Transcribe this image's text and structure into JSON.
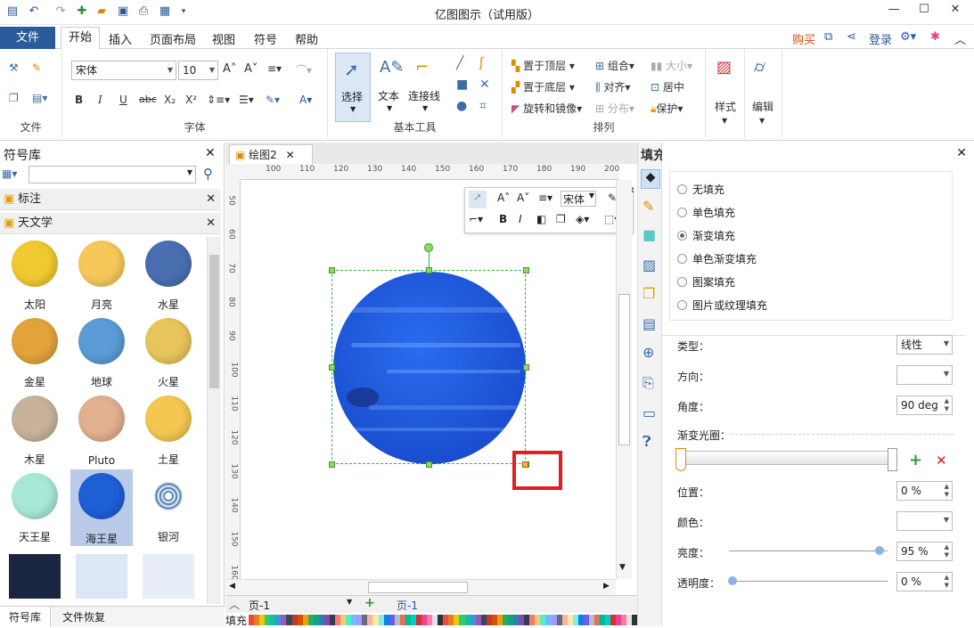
{
  "app": {
    "title": "亿图图示（试用版）"
  },
  "menu": {
    "file": "文件",
    "tabs": [
      "开始",
      "插入",
      "页面布局",
      "视图",
      "符号",
      "帮助"
    ],
    "buy": "购买",
    "login": "登录"
  },
  "ribbon": {
    "file_group": "文件",
    "font_group": "字体",
    "font_name": "宋体",
    "font_size": "10",
    "basic_tools": "基本工具",
    "select": "选择",
    "text": "文本",
    "connector": "连接线",
    "arrange": "排列",
    "top": "置于顶层",
    "bottom": "置于底层",
    "rotate": "旋转和镜像",
    "group": "组合",
    "align": "对齐",
    "distribute": "分布",
    "size": "大小",
    "center": "居中",
    "protect": "保护",
    "style": "样式",
    "edit": "编辑"
  },
  "library": {
    "title": "符号库",
    "sections": [
      "标注",
      "天文学"
    ],
    "symbols": [
      {
        "label": "太阳",
        "color": "#f0c92e"
      },
      {
        "label": "月亮",
        "color": "#f6c85a"
      },
      {
        "label": "水星",
        "color": "#4a6fb0"
      },
      {
        "label": "金星",
        "color": "#e2a33a"
      },
      {
        "label": "地球",
        "color": "#5b9bd5"
      },
      {
        "label": "火星",
        "color": "#e8c55a"
      },
      {
        "label": "木星",
        "color": "#c8b29a"
      },
      {
        "label": "Pluto",
        "color": "#e0b08f"
      },
      {
        "label": "土星",
        "color": "#f4c750"
      },
      {
        "label": "天王星",
        "color": "#a8e8d8"
      },
      {
        "label": "海王星",
        "color": "#1f5fd6"
      },
      {
        "label": "银河",
        "color": "#ffffff"
      }
    ],
    "bottom_tabs": [
      "符号库",
      "文件恢复"
    ]
  },
  "document": {
    "tab": "绘图2",
    "ruler_h": [
      "100",
      "110",
      "120",
      "130",
      "140",
      "150",
      "160",
      "170",
      "180",
      "190",
      "200"
    ],
    "ruler_v": [
      "50",
      "60",
      "70",
      "80",
      "90",
      "100",
      "110",
      "120",
      "130",
      "140",
      "150",
      "160"
    ],
    "page_label": "页-1",
    "page_tab": "页-1",
    "fill_label": "填充"
  },
  "floatbar": {
    "font": "宋体"
  },
  "fill_panel": {
    "title": "填充",
    "options": [
      "无填充",
      "单色填充",
      "渐变填充",
      "单色渐变填充",
      "图案填充",
      "图片或纹理填充"
    ],
    "selected": 2,
    "type_label": "类型：",
    "type_value": "线性",
    "direction_label": "方向：",
    "angle_label": "角度：",
    "angle_value": "90 deg",
    "stops_label": "渐变光圈：",
    "position_label": "位置：",
    "position_value": "0 %",
    "color_label": "颜色：",
    "brightness_label": "亮度：",
    "brightness_value": "95 %",
    "transparency_label": "透明度：",
    "transparency_value": "0 %"
  }
}
